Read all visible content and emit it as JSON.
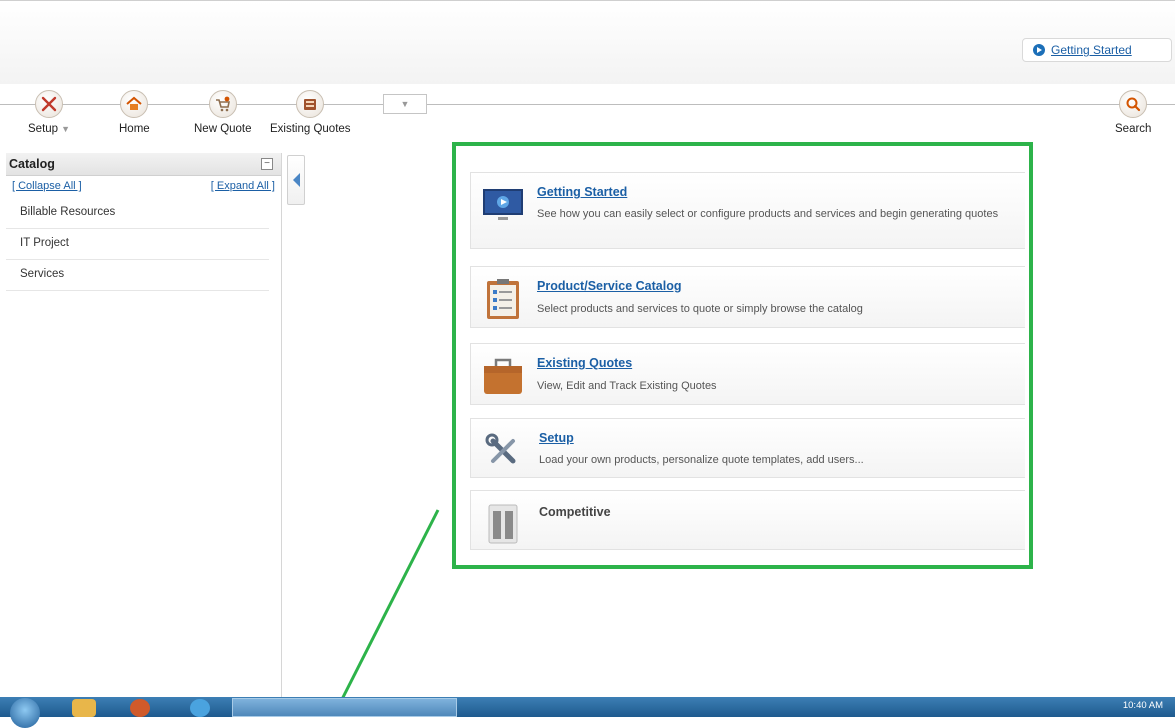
{
  "header": {
    "getting_started_link": "Getting Started"
  },
  "toolbar": {
    "items": [
      {
        "label": "Setup",
        "icon": "wrench-icon",
        "has_dropdown": true
      },
      {
        "label": "Home",
        "icon": "home-icon"
      },
      {
        "label": "New Quote",
        "icon": "new-quote-icon"
      },
      {
        "label": "Existing Quotes",
        "icon": "existing-quotes-icon"
      }
    ],
    "search_label": "Search",
    "dropdown_arrow": "▼"
  },
  "catalog": {
    "title": "Catalog",
    "minimize": "−",
    "collapse_all": "[ Collapse All ]",
    "expand_all": "[ Expand All ]",
    "items": [
      "Billable Resources",
      "IT Project",
      "Services"
    ]
  },
  "cards": [
    {
      "title": "Getting Started",
      "desc": "See how you can easily select or configure products and services and begin generating quotes",
      "icon": "monitor-play-icon"
    },
    {
      "title": "Product/Service Catalog",
      "desc": "Select products and services to quote or simply browse the catalog",
      "icon": "clipboard-icon"
    },
    {
      "title": "Existing Quotes",
      "desc": "View, Edit and Track Existing Quotes",
      "icon": "briefcase-icon"
    },
    {
      "title": "Setup",
      "desc": "Load your own products, personalize quote templates, add users...",
      "icon": "tools-icon"
    },
    {
      "title": "Competitive",
      "desc": "",
      "icon": "server-icon"
    }
  ],
  "taskbar": {
    "clock": "10:40 AM"
  },
  "colors": {
    "accent": "#1b5fa5",
    "highlight_frame": "#2db34a",
    "taskbar": "#1e5a8e"
  }
}
